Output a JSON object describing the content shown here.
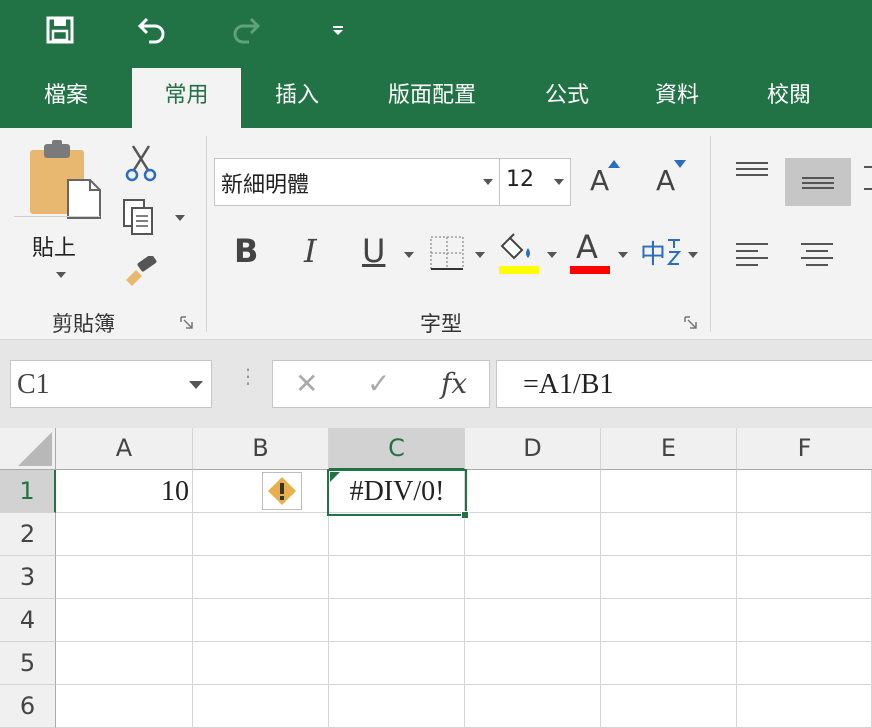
{
  "quick_access": {
    "icons": [
      "save-icon",
      "undo-icon",
      "redo-icon",
      "customize-qat-icon"
    ]
  },
  "tabs": [
    {
      "label": "檔案",
      "active": false
    },
    {
      "label": "常用",
      "active": true
    },
    {
      "label": "插入",
      "active": false
    },
    {
      "label": "版面配置",
      "active": false
    },
    {
      "label": "公式",
      "active": false
    },
    {
      "label": "資料",
      "active": false
    },
    {
      "label": "校閱",
      "active": false
    }
  ],
  "ribbon": {
    "clipboard": {
      "paste_label": "貼上",
      "group_label": "剪貼簿"
    },
    "font": {
      "font_name": "新細明體",
      "font_size": "12",
      "bold": "B",
      "italic": "I",
      "underline": "U",
      "font_color_glyph": "A",
      "grow_glyph": "A",
      "shrink_glyph": "A",
      "phonetic_glyph": "中",
      "group_label": "字型",
      "fill_color": "#ffff00",
      "font_color": "#ff0000"
    }
  },
  "formula_bar": {
    "name_box": "C1",
    "cancel": "✕",
    "enter": "✓",
    "fx": "fx",
    "formula": "=A1/B1"
  },
  "grid": {
    "columns": [
      "A",
      "B",
      "C",
      "D",
      "E",
      "F"
    ],
    "selected_column": "C",
    "rows": [
      "1",
      "2",
      "3",
      "4",
      "5",
      "6"
    ],
    "selected_row": "1",
    "cells": {
      "A1": "10",
      "C1": "#DIV/0!"
    }
  },
  "colors": {
    "accent": "#217346",
    "error_warning": "#e8b04a"
  }
}
